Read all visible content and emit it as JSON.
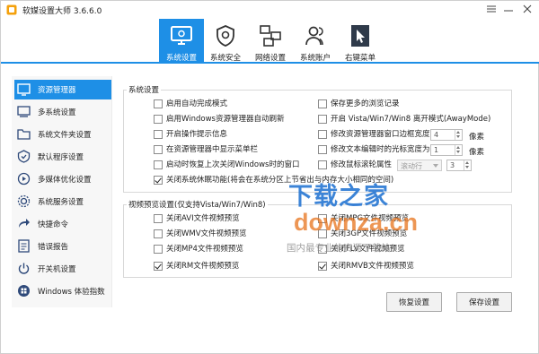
{
  "window": {
    "title": "软媒设置大师 3.6.6.0"
  },
  "tabs": [
    {
      "label": "系统设置",
      "icon": "settings-display-icon",
      "active": true
    },
    {
      "label": "系统安全",
      "icon": "shield-icon",
      "active": false
    },
    {
      "label": "网络设置",
      "icon": "network-icon",
      "active": false
    },
    {
      "label": "系统账户",
      "icon": "users-icon",
      "active": false
    },
    {
      "label": "右键菜单",
      "icon": "cursor-menu-icon",
      "active": false
    }
  ],
  "sidebar": {
    "items": [
      {
        "label": "资源管理器",
        "icon": "explorer-icon",
        "active": true
      },
      {
        "label": "多系统设置",
        "icon": "multi-system-icon",
        "active": false
      },
      {
        "label": "系统文件夹设置",
        "icon": "folder-icon",
        "active": false
      },
      {
        "label": "默认程序设置",
        "icon": "default-program-icon",
        "active": false
      },
      {
        "label": "多媒体优化设置",
        "icon": "media-icon",
        "active": false
      },
      {
        "label": "系统服务设置",
        "icon": "service-icon",
        "active": false
      },
      {
        "label": "快捷命令",
        "icon": "shortcut-icon",
        "active": false
      },
      {
        "label": "错误报告",
        "icon": "report-icon",
        "active": false
      },
      {
        "label": "开关机设置",
        "icon": "power-icon",
        "active": false
      },
      {
        "label": "Windows 体验指数",
        "icon": "windows-icon",
        "active": false
      }
    ]
  },
  "system_group": {
    "title": "系统设置",
    "left_options": [
      {
        "label": "启用自动完成模式",
        "checked": false
      },
      {
        "label": "启用Windows资源管理器自动刷新",
        "checked": false
      },
      {
        "label": "开启操作提示信息",
        "checked": false
      },
      {
        "label": "在资源管理器中显示菜单栏",
        "checked": false
      },
      {
        "label": "启动时恢复上次关闭Windows时的窗口",
        "checked": false
      },
      {
        "label": "关闭系统休眠功能(将会在系统分区上节省出与内存大小相同的空间)",
        "checked": true
      }
    ],
    "right_options": [
      {
        "label": "保存更多的浏览记录",
        "checked": false
      },
      {
        "label": "开启 Vista/Win7/Win8 离开模式(AwayMode)",
        "checked": false
      },
      {
        "label": "修改资源管理器窗口边框宽度",
        "checked": false
      },
      {
        "label": "修改文本编辑时的光标宽度为",
        "checked": false
      },
      {
        "label": "修改鼠标滚轮属性",
        "checked": false
      }
    ],
    "border_width": {
      "value": "4",
      "unit": "像素"
    },
    "cursor_width": {
      "value": "1",
      "unit": "像素"
    },
    "scroll_mode": {
      "value": "滚动行"
    },
    "scroll_lines": {
      "value": "3"
    }
  },
  "preview_group": {
    "title": "视频预览设置(仅支持Vista/Win7/Win8)",
    "left_options": [
      {
        "label": "关闭AVI文件视频预览",
        "checked": false
      },
      {
        "label": "关闭WMV文件视频预览",
        "checked": false
      },
      {
        "label": "关闭MP4文件视频预览",
        "checked": false
      },
      {
        "label": "关闭RM文件视频预览",
        "checked": true
      }
    ],
    "right_options": [
      {
        "label": "关闭MPG文件视频预览",
        "checked": false
      },
      {
        "label": "关闭3GP文件视频预览",
        "checked": false
      },
      {
        "label": "关闭FLV文件视频预览",
        "checked": false
      },
      {
        "label": "关闭RMVB文件视频预览",
        "checked": true
      }
    ]
  },
  "buttons": {
    "restore": "恢复设置",
    "save": "保存设置"
  },
  "watermark": {
    "line1": "下载之家",
    "line2": "downza.cn",
    "line3": "国内最专业的资源下载站！"
  },
  "colors": {
    "accent": "#1e8fe6"
  }
}
